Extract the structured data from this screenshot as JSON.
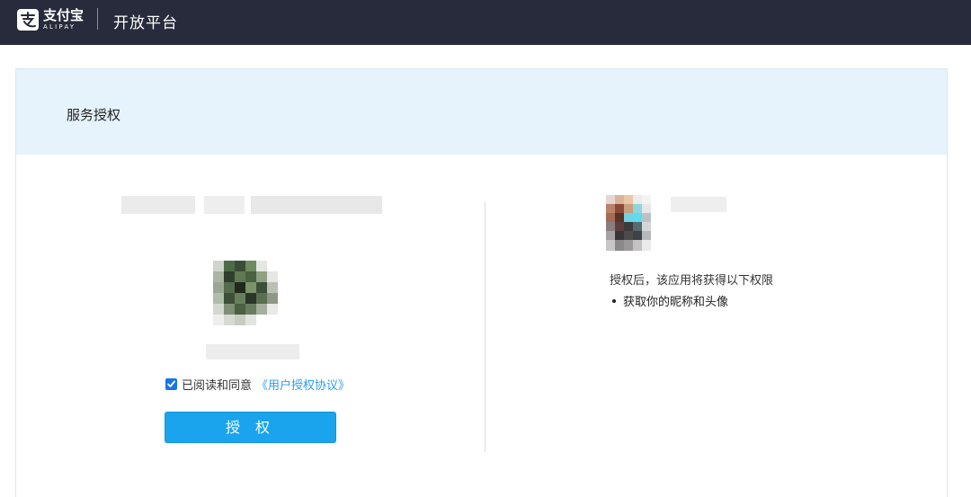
{
  "header": {
    "logo_cn": "支付宝",
    "logo_en": "ALIPAY",
    "title": "开放平台"
  },
  "panel": {
    "title": "服务授权"
  },
  "consent": {
    "checkbox_checked": true,
    "agree_text": "已阅读和同意",
    "agreement_link": "《用户授权协议》"
  },
  "actions": {
    "authorize_label": "授 权"
  },
  "permissions": {
    "intro": "授权后，该应用将获得以下权限",
    "items": [
      "获取你的昵称和头像"
    ]
  },
  "colors": {
    "topbar": "#272b3b",
    "header_band": "#e6f3fc",
    "primary_button": "#1aa4ee",
    "link": "#2d9df2"
  }
}
